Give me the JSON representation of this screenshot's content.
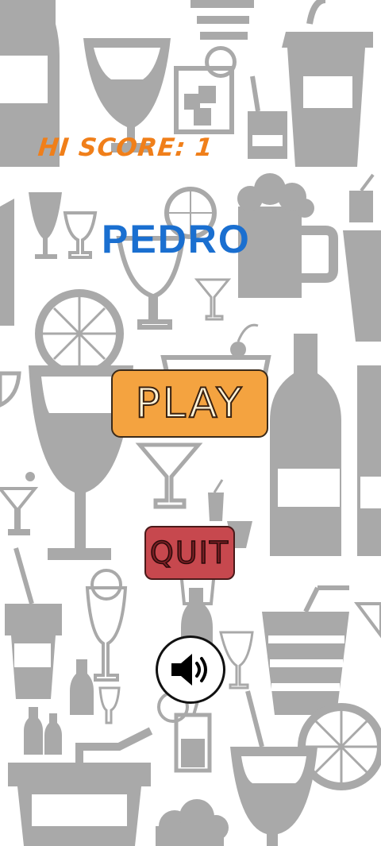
{
  "hud": {
    "hi_score_label": "HI SCORE: 1"
  },
  "player": {
    "name": "PEDRO"
  },
  "menu": {
    "play_label": "PLAY",
    "quit_label": "QUIT"
  },
  "sound": {
    "icon": "speaker-on-icon"
  },
  "colors": {
    "hi_score": "#f07f1a",
    "player_name": "#1a6fd0",
    "play_button": "#f4a340",
    "quit_button": "#c7484e",
    "background_pattern": "#a8a8a8"
  }
}
